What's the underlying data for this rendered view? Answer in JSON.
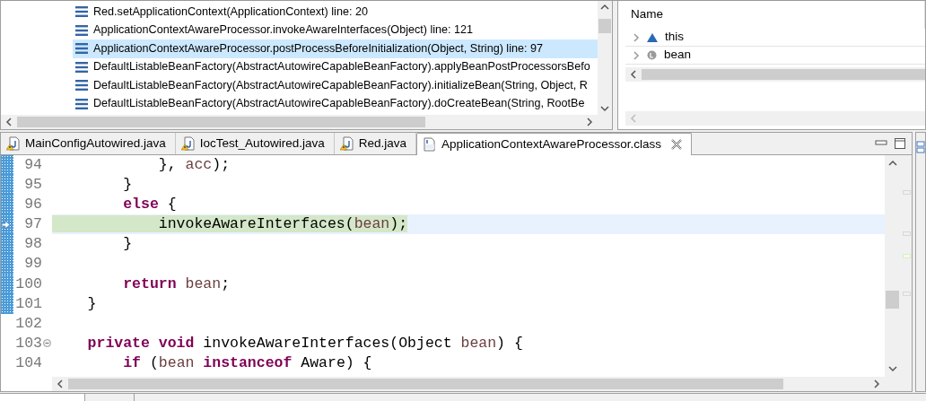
{
  "stack_frames": [
    {
      "label": "Red.setApplicationContext(ApplicationContext) line: 20",
      "selected": false
    },
    {
      "label": "ApplicationContextAwareProcessor.invokeAwareInterfaces(Object) line: 121",
      "selected": false
    },
    {
      "label": "ApplicationContextAwareProcessor.postProcessBeforeInitialization(Object, String) line: 97",
      "selected": true
    },
    {
      "label": "DefaultListableBeanFactory(AbstractAutowireCapableBeanFactory).applyBeanPostProcessorsBefo",
      "selected": false
    },
    {
      "label": "DefaultListableBeanFactory(AbstractAutowireCapableBeanFactory).initializeBean(String, Object, R",
      "selected": false
    },
    {
      "label": "DefaultListableBeanFactory(AbstractAutowireCapableBeanFactory).doCreateBean(String, RootBe",
      "selected": false
    }
  ],
  "variables": {
    "column": "Name",
    "rows": [
      {
        "name": "this",
        "kind": "object"
      },
      {
        "name": "bean",
        "kind": "local"
      }
    ]
  },
  "editor_tabs": [
    {
      "label": "MainConfigAutowired.java",
      "kind": "java",
      "selected": false
    },
    {
      "label": "IocTest_Autowired.java",
      "kind": "java",
      "selected": false
    },
    {
      "label": "Red.java",
      "kind": "java",
      "selected": false
    },
    {
      "label": "ApplicationContextAwareProcessor.class",
      "kind": "class",
      "selected": true
    }
  ],
  "code_lines": [
    {
      "number": "94",
      "marked": true,
      "current": false,
      "foldable": false,
      "tokens": [
        {
          "text": "            }, ",
          "kind": "plain"
        },
        {
          "text": "acc",
          "kind": "var"
        },
        {
          "text": ");",
          "kind": "plain"
        }
      ]
    },
    {
      "number": "95",
      "marked": true,
      "current": false,
      "foldable": false,
      "tokens": [
        {
          "text": "        }",
          "kind": "plain"
        }
      ]
    },
    {
      "number": "96",
      "marked": true,
      "current": false,
      "foldable": false,
      "tokens": [
        {
          "text": "        else",
          "kind": "kw"
        },
        {
          "text": " {",
          "kind": "plain"
        }
      ]
    },
    {
      "number": "97",
      "marked": true,
      "current": true,
      "foldable": false,
      "tokens": [
        {
          "text": "            invokeAwareInterfaces(",
          "kind": "plain"
        },
        {
          "text": "bean",
          "kind": "var"
        },
        {
          "text": ");",
          "kind": "plain"
        }
      ]
    },
    {
      "number": "98",
      "marked": true,
      "current": false,
      "foldable": false,
      "tokens": [
        {
          "text": "        }",
          "kind": "plain"
        }
      ]
    },
    {
      "number": "99",
      "marked": true,
      "current": false,
      "foldable": false
    },
    {
      "number": "100",
      "marked": true,
      "current": false,
      "foldable": false,
      "tokens": [
        {
          "text": "        return",
          "kind": "kw"
        },
        {
          "text": " bean",
          "kind": "var"
        },
        {
          "text": ";",
          "kind": "plain"
        }
      ]
    },
    {
      "number": "101",
      "marked": true,
      "current": false,
      "foldable": false,
      "tokens": [
        {
          "text": "    }",
          "kind": "plain"
        }
      ]
    },
    {
      "number": "102",
      "marked": false,
      "current": false,
      "foldable": false
    },
    {
      "number": "103",
      "marked": false,
      "current": false,
      "foldable": true,
      "tokens": [
        {
          "text": "    private void",
          "kind": "kw"
        },
        {
          "text": " invokeAwareInterfaces(Object",
          "kind": "plain"
        },
        {
          "text": " bean",
          "kind": "var"
        },
        {
          "text": ") {",
          "kind": "plain"
        }
      ]
    },
    {
      "number": "104",
      "marked": false,
      "current": false,
      "foldable": false,
      "tokens": [
        {
          "text": "        if",
          "kind": "kw"
        },
        {
          "text": " (",
          "kind": "plain"
        },
        {
          "text": "bean",
          "kind": "var"
        },
        {
          "text": " instanceof",
          "kind": "kw"
        },
        {
          "text": " Aware) {",
          "kind": "plain"
        }
      ]
    }
  ]
}
